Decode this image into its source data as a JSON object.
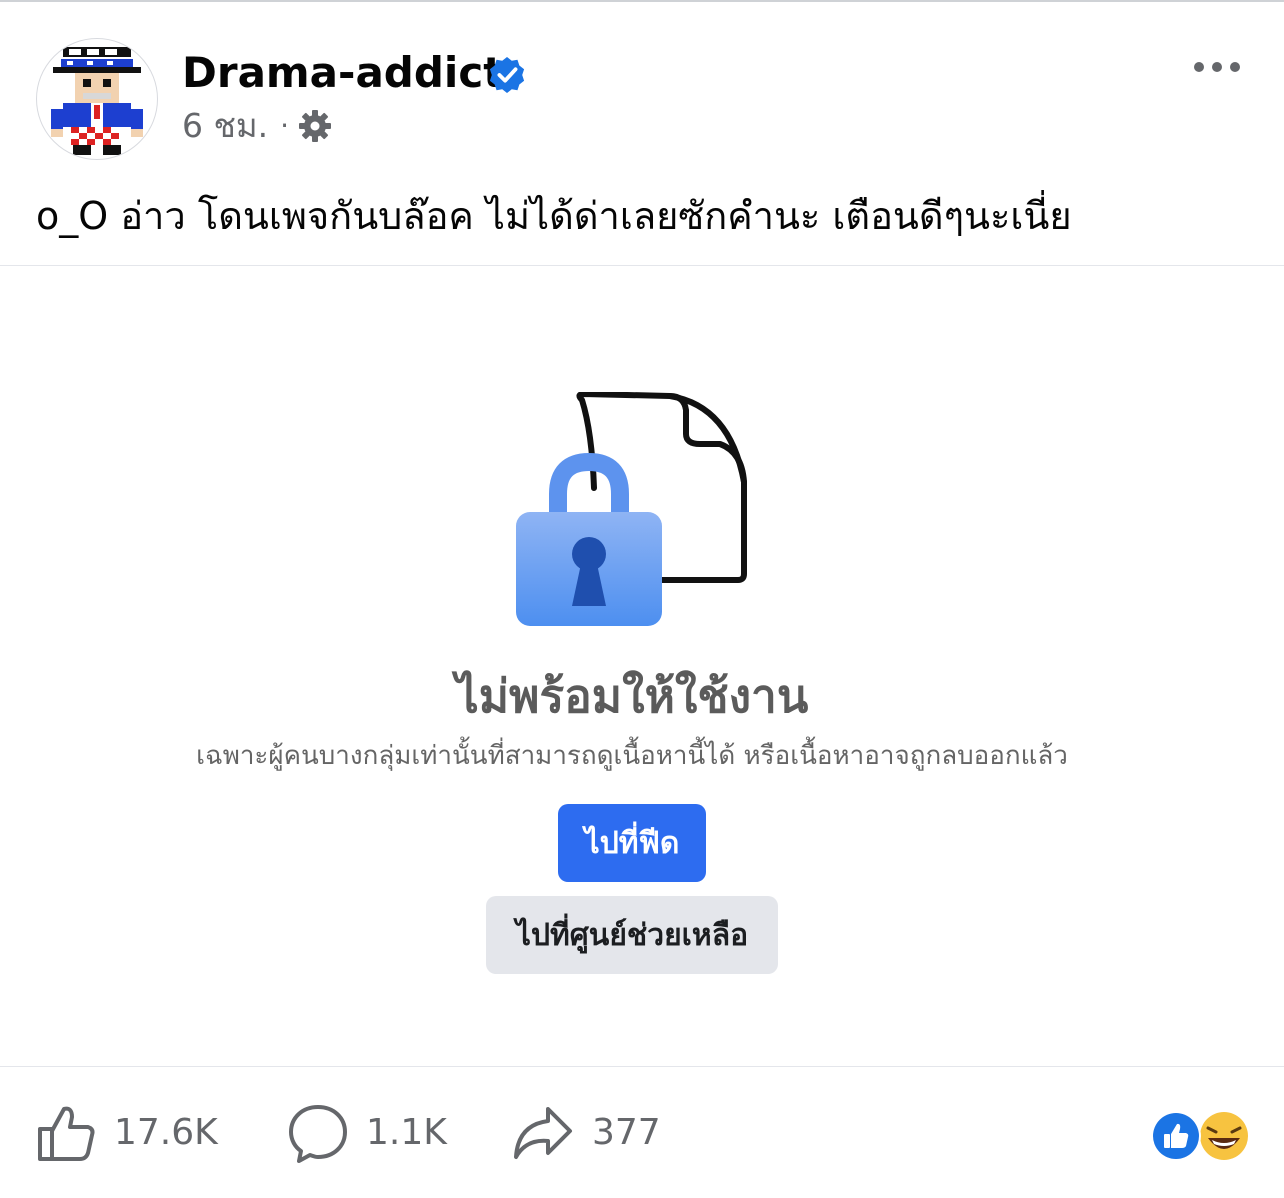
{
  "post": {
    "author": "Drama-addict",
    "time": "6 ชม.",
    "separator": "·",
    "text": "o_O อ่าว โดนเพจกันบล๊อค ไม่ได้ด่าเลยซักคำนะ เตือนดีๆนะเนี่ย"
  },
  "icons": {
    "verified": "verified-badge-icon",
    "audience": "gear-icon",
    "more": "more-options-icon",
    "lock": "lock-icon",
    "document": "document-icon",
    "like": "thumbs-up-icon",
    "comment": "comment-bubble-icon",
    "share": "share-arrow-icon",
    "reactions": [
      "like-reaction-icon",
      "laugh-reaction-icon"
    ]
  },
  "unavailable": {
    "title": "ไม่พร้อมให้ใช้งาน",
    "description": "เฉพาะผู้คนบางกลุ่มเท่านั้นที่สามารถดูเนื้อหานี้ได้ หรือเนื้อหาอาจถูกลบออกแล้ว",
    "feed_button": "ไปที่ฟีด",
    "help_button": "ไปที่ศูนย์ช่วยเหลือ"
  },
  "actions": {
    "likes": "17.6K",
    "comments": "1.1K",
    "shares": "377"
  },
  "colors": {
    "primary_button": "#2d6cf0",
    "secondary_button": "#e4e6eb",
    "verified": "#1b74e4",
    "muted_text": "#65676b"
  }
}
